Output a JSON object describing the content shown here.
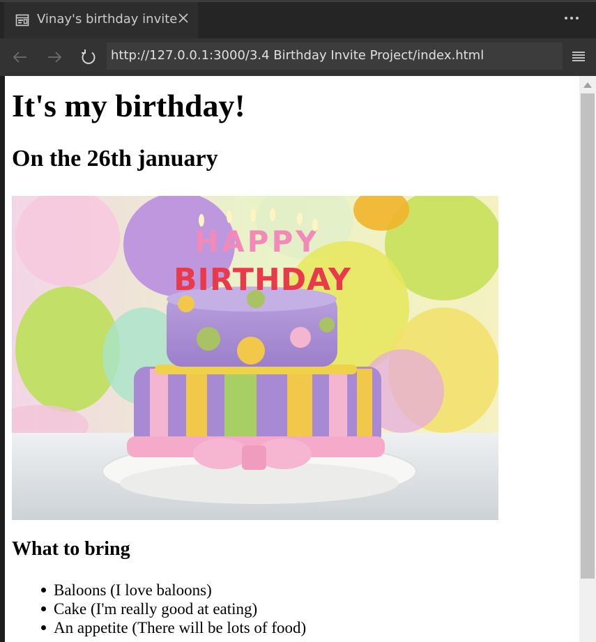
{
  "browser": {
    "tab": {
      "title": "Vinay's birthday invite",
      "icon": "page-icon",
      "close_icon": "close-icon"
    },
    "more_icon": "more-icon",
    "nav": {
      "back_icon": "back-arrow-icon",
      "forward_icon": "forward-arrow-icon",
      "reload_icon": "reload-icon",
      "url": "http://127.0.0.1:3000/3.4 Birthday Invite Project/index.html",
      "menu_icon": "menu-icon"
    }
  },
  "page": {
    "heading": "It's my birthday!",
    "subheading": "On the 26th january",
    "image": {
      "description": "birthday-cake-photo",
      "cake_text_top": "HAPPY",
      "cake_text_bottom": "BIRTHDAY"
    },
    "bring_heading": "What to bring",
    "items": [
      "Baloons (I love baloons)",
      "Cake (I'm really good at eating)",
      "An appetite (There will be lots of food)"
    ]
  },
  "colors": {
    "tab_bg": "#2d2d2d",
    "navbar_bg": "#333333",
    "url_bg": "#3c3c3c",
    "page_bg": "#ffffff"
  }
}
